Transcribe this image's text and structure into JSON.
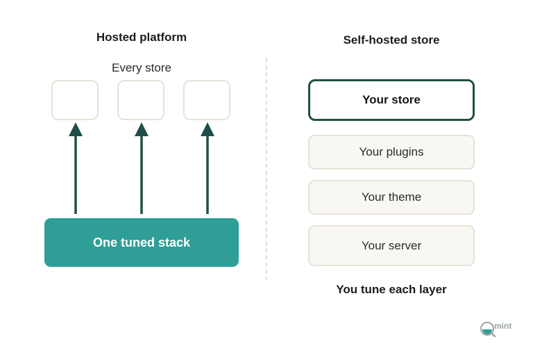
{
  "left": {
    "heading": "Hosted platform",
    "boxes_label": "Every store",
    "stack_label": "One tuned stack"
  },
  "right": {
    "heading": "Self-hosted store",
    "layers": [
      "Your store",
      "Your plugins",
      "Your theme",
      "Your server"
    ],
    "footer": "You tune each layer"
  },
  "logo": {
    "text": "mint",
    "icon": "magnifier-logo-icon"
  },
  "colors": {
    "teal": "#2e9e97",
    "dark_green": "#1f4f46",
    "box_border": "#e6e2d8",
    "layer_fill": "#f9f7f2"
  }
}
